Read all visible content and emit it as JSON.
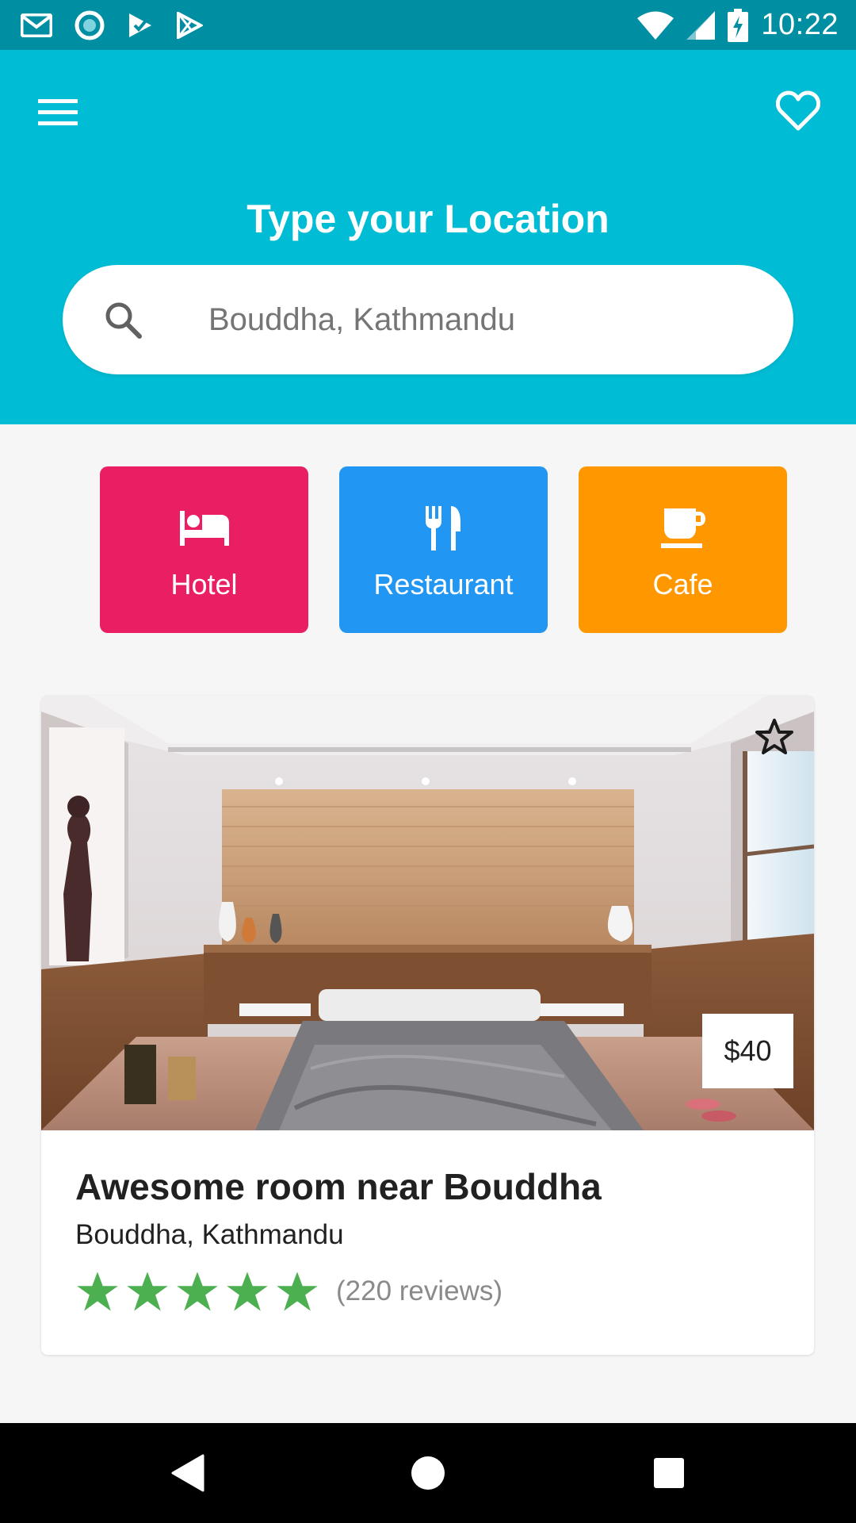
{
  "status_bar": {
    "time": "10:22",
    "left_icons": [
      "gmail-icon",
      "circle-app-icon",
      "tasks-icon",
      "play-store-icon"
    ],
    "right_icons": [
      "wifi-icon",
      "signal-icon",
      "battery-charging-icon"
    ]
  },
  "header": {
    "title": "Type your Location",
    "menu_icon": "menu-icon",
    "favorite_icon": "heart-icon",
    "background_color": "#00bcd4"
  },
  "search": {
    "value": "Bouddha, Kathmandu",
    "icon": "search-icon"
  },
  "categories": [
    {
      "label": "Hotel",
      "icon": "bed-icon",
      "color": "#e91e63"
    },
    {
      "label": "Restaurant",
      "icon": "utensils-icon",
      "color": "#2196f3"
    },
    {
      "label": "Cafe",
      "icon": "coffee-cup-icon",
      "color": "#ff9800"
    }
  ],
  "listing": {
    "price": "$40",
    "title": "Awesome room near Bouddha",
    "location": "Bouddha, Kathmandu",
    "rating_stars": 5,
    "reviews_text": "(220 reviews)",
    "star_color": "#4caf50",
    "favorite_icon": "star-outline-icon"
  },
  "nav_bar": {
    "buttons": [
      "back-icon",
      "home-icon",
      "recents-icon"
    ]
  }
}
